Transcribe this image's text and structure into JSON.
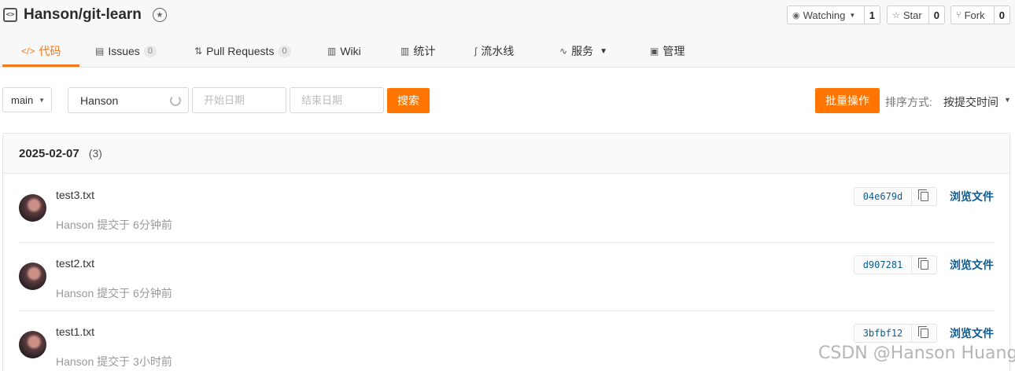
{
  "repo": {
    "name": "Hanson/git-learn"
  },
  "actions": {
    "watch": {
      "label": "Watching",
      "count": "1"
    },
    "star": {
      "label": "Star",
      "count": "0"
    },
    "fork": {
      "label": "Fork",
      "count": "0"
    }
  },
  "nav": {
    "items": [
      {
        "label": "代码",
        "icon": "code-icon",
        "active": true
      },
      {
        "label": "Issues",
        "count": "0",
        "icon": "issues-icon"
      },
      {
        "label": "Pull Requests",
        "count": "0",
        "icon": "pull-request-icon"
      },
      {
        "label": "Wiki",
        "icon": "wiki-icon"
      },
      {
        "label": "统计",
        "icon": "chart-icon"
      },
      {
        "label": "流水线",
        "icon": "pipeline-icon"
      },
      {
        "label": "服务",
        "icon": "service-icon"
      },
      {
        "label": "管理",
        "icon": "manage-icon"
      }
    ],
    "accent": "#f37b1d"
  },
  "filters": {
    "branch": "main",
    "author": "Hanson",
    "start_placeholder": "开始日期",
    "end_placeholder": "结束日期",
    "search_label": "搜索",
    "batch_label": "批量操作",
    "sort_label": "排序方式:",
    "sort_value": "按提交时间"
  },
  "commits": {
    "date": "2025-02-07",
    "count": "(3)",
    "browse_label": "浏览文件",
    "items": [
      {
        "message": "test3.txt",
        "meta": "Hanson 提交于 6分钟前",
        "sha": "04e679d"
      },
      {
        "message": "test2.txt",
        "meta": "Hanson 提交于 6分钟前",
        "sha": "d907281"
      },
      {
        "message": "test1.txt",
        "meta": "Hanson 提交于 3小时前",
        "sha": "3bfbf12"
      }
    ]
  },
  "watermark": "CSDN @Hanson Huang"
}
